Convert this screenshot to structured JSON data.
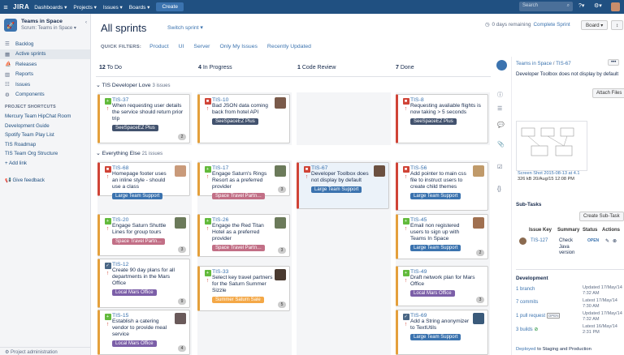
{
  "topnav": {
    "logo": "JIRA",
    "links": [
      "Dashboards ▾",
      "Projects ▾",
      "Issues ▾",
      "Boards ▾"
    ],
    "create": "Create",
    "search_placeholder": "Search",
    "help": "?▾",
    "settings": "⚙▾"
  },
  "sidebar": {
    "project_name": "Teams in Space",
    "project_sub": "Scrum: Teams in Space ▾",
    "items": [
      {
        "label": "Backlog",
        "icon": "backlog-icon",
        "glyph": "☰"
      },
      {
        "label": "Active sprints",
        "icon": "board-icon",
        "glyph": "▦"
      },
      {
        "label": "Releases",
        "icon": "ship-icon",
        "glyph": "⛵"
      },
      {
        "label": "Reports",
        "icon": "chart-icon",
        "glyph": "▥"
      },
      {
        "label": "Issues",
        "icon": "issues-icon",
        "glyph": "☷"
      },
      {
        "label": "Components",
        "icon": "puzzle-icon",
        "glyph": "⚙"
      }
    ],
    "shortcuts_header": "PROJECT SHORTCUTS",
    "shortcuts": [
      "Mercury Team HipChat Room",
      "Development Guide",
      "Spotify Team Play List",
      "TIS Roadmap",
      "TIS Team Org Structure"
    ],
    "add_link": "Add link",
    "feedback": "Give feedback",
    "bottom": "Project administration"
  },
  "board": {
    "title": "All sprints",
    "switch": "Switch sprint ▾",
    "quick_filters_label": "QUICK FILTERS:",
    "quick_filters": [
      "Product",
      "UI",
      "Server",
      "Only My Issues",
      "Recently Updated"
    ],
    "days_remaining": "0 days remaining",
    "complete_sprint": "Complete Sprint",
    "board_btn": "Board ▾",
    "columns": [
      {
        "count": "12",
        "name": "To Do"
      },
      {
        "count": "4",
        "name": "In Progress"
      },
      {
        "count": "1",
        "name": "Code Review"
      },
      {
        "count": "7",
        "name": "Done"
      }
    ],
    "swimlanes": [
      {
        "name": "TIS Developer Love",
        "count": "3 issues"
      },
      {
        "name": "Everything Else",
        "count": "21 issues"
      }
    ]
  },
  "cards": [
    {
      "key": "TIS-37",
      "summary": "When requesting user details the service should return prior trip",
      "epic": "SeeSpaceEZ Plus",
      "epic_color": "#42526e",
      "badge": "2",
      "type": "story",
      "border": "#e4a03c"
    },
    {
      "key": "TIS-10",
      "summary": "Bad JSON data coming back from hotel API",
      "epic": "SeeSpaceEZ Plus",
      "epic_color": "#42526e",
      "badge": "",
      "type": "bug",
      "border": "#e4a03c"
    },
    {
      "key": "TIS-8",
      "summary": "Requesting avaliable flights is now taking > 5 seconds",
      "epic": "SeeSpaceEZ Plus",
      "epic_color": "#42526e",
      "badge": "",
      "type": "bug",
      "border": "#d04437"
    },
    {
      "key": "TIS-68",
      "summary": "Homepage footer uses an inline style - should use a class",
      "epic": "Large Team Support",
      "epic_color": "#3b73af",
      "badge": "",
      "type": "bug",
      "border": "#d04437"
    },
    {
      "key": "TIS-17",
      "summary": "Engage Saturn's Rings Resort as a preferred provider",
      "epic": "Space Travel Partn…",
      "epic_color": "#c26f86",
      "badge": "3",
      "type": "story",
      "border": "#e4a03c"
    },
    {
      "key": "TIS-67",
      "summary": "Developer Toolbox does not display by default",
      "epic": "Large Team Support",
      "epic_color": "#3b73af",
      "badge": "",
      "type": "bug",
      "border": "#d04437"
    },
    {
      "key": "TIS-56",
      "summary": "Add pointer to main css file to instruct users to create child themes",
      "epic": "Large Team Support",
      "epic_color": "#3b73af",
      "badge": "",
      "type": "bug",
      "border": "#d04437"
    },
    {
      "key": "TIS-20",
      "summary": "Engage Saturn Shuttle Lines for group tours",
      "epic": "Space Travel Partn…",
      "epic_color": "#c26f86",
      "badge": "3",
      "type": "story",
      "border": "#e4a03c"
    },
    {
      "key": "TIS-26",
      "summary": "Engage the Red Titan Hotel as a preferred provider",
      "epic": "Space Travel Partn…",
      "epic_color": "#c26f86",
      "badge": "3",
      "type": "story",
      "border": "#e4a03c"
    },
    {
      "key": "TIS-45",
      "summary": "Email non registered users to sign up with Teams In Space",
      "epic": "Large Team Support",
      "epic_color": "#3b73af",
      "badge": "2",
      "type": "story",
      "border": "#e4a03c"
    },
    {
      "key": "TIS-12",
      "summary": "Create 90 day plans for all departments in the Mars Office",
      "epic": "Local Mars Office",
      "epic_color": "#7c5fa8",
      "badge": "9",
      "type": "task",
      "border": "#e4a03c"
    },
    {
      "key": "TIS-33",
      "summary": "Select key travel partners for the Saturn Summer Sizzle",
      "epic": "Summer Saturn Sale",
      "epic_color": "#f4a847",
      "badge": "5",
      "type": "story",
      "border": "#e4a03c"
    },
    {
      "key": "TIS-49",
      "summary": "Draft network plan for Mars Office",
      "epic": "Local Mars Office",
      "epic_color": "#7c5fa8",
      "badge": "3",
      "type": "story",
      "border": "#e4a03c"
    },
    {
      "key": "TIS-15",
      "summary": "Establish a catering vendor to provide meal service",
      "epic": "Local Mars Office",
      "epic_color": "#7c5fa8",
      "badge": "4",
      "type": "story",
      "border": "#e4a03c"
    },
    {
      "key": "TIS-69",
      "summary": "Add a String anonymizer to TextUtils",
      "epic": "Large Team Support",
      "epic_color": "#3b73af",
      "badge": "",
      "type": "task",
      "border": "#e4a03c"
    }
  ],
  "detail": {
    "breadcrumb_project": "Teams in Space",
    "breadcrumb_key": "TIS-67",
    "summary": "Developer Toolbox does not display by default",
    "attach_files": "Attach Files",
    "screenshot_name": "Screen Shot 2015-08-13 at 4.1",
    "screenshot_meta": "326 kB   20/Aug/15 12:08 PM",
    "subtasks_title": "Sub-Tasks",
    "create_subtask": "Create Sub-Task",
    "subtask_headers": [
      "Issue Key",
      "Summary",
      "Status",
      "Actions"
    ],
    "subtask": {
      "key": "TIS-127",
      "summary": "Check Java version",
      "status": "OPEN"
    },
    "development_title": "Development",
    "dev": [
      {
        "left": "1 branch",
        "right": "Updated 17/May/14 7:32 AM"
      },
      {
        "left": "7 commits",
        "right": "Latest 17/May/14 7:30 AM"
      },
      {
        "left": "1 pull request",
        "badge": "OPEN",
        "right": "Updated 17/May/14 7:32 AM"
      },
      {
        "left": "3 builds",
        "right": "Latest 16/May/14 2:31 PM"
      }
    ],
    "deploy_link": "Deployed",
    "deploy_text": "to Staging and Production"
  }
}
